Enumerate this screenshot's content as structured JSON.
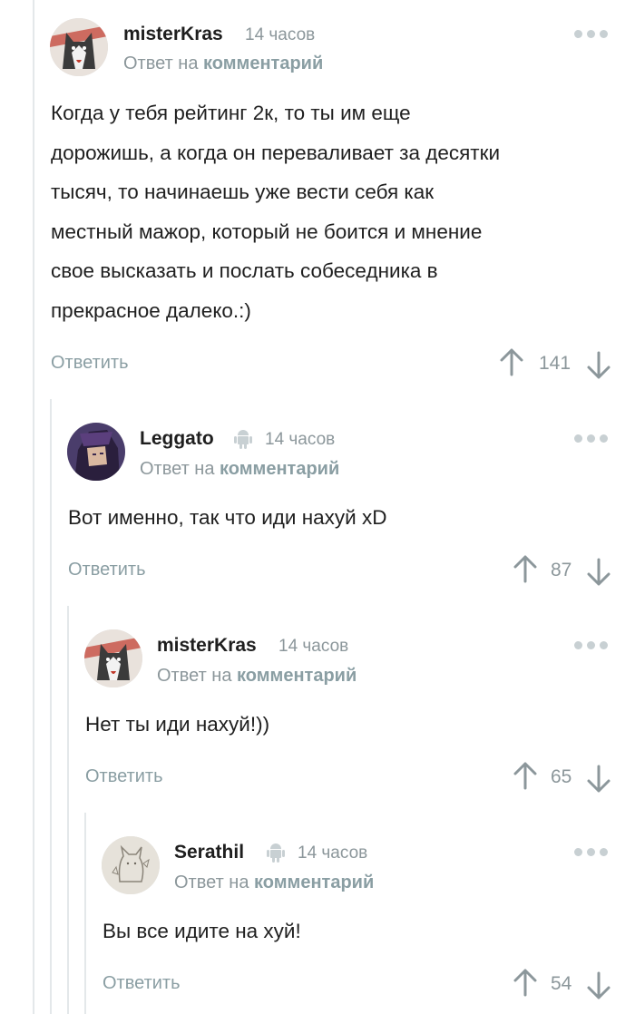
{
  "colors": {
    "accent_link": "#8a9ea3",
    "muted_text": "#8c979b",
    "thread_line": "#e4e8ea",
    "icon_gray": "#c8d0d3"
  },
  "comments": [
    {
      "author": "misterKras",
      "time": "14 часов",
      "reply_prefix": "Ответ на",
      "reply_link": "комментарий",
      "avatar": "husky-avatar",
      "has_android_icon": false,
      "text_lines": [
        "Когда у тебя рейтинг 2к, то ты им еще",
        "дорожишь, а когда он переваливает за десятки",
        "тысяч, то начинаешь уже вести себя как",
        "местный мажор, который не боится и мнение",
        "свое высказать и послать собеседника в",
        "прекрасное далеко.:)"
      ],
      "reply_button": "Ответить",
      "rating": "141"
    },
    {
      "author": "Leggato",
      "time": "14 часов",
      "reply_prefix": "Ответ на",
      "reply_link": "комментарий",
      "avatar": "anime-character-avatar",
      "has_android_icon": true,
      "text_lines": [
        "Вот именно, так что иди нахуй xD"
      ],
      "reply_button": "Ответить",
      "rating": "87"
    },
    {
      "author": "misterKras",
      "time": "14 часов",
      "reply_prefix": "Ответ на",
      "reply_link": "комментарий",
      "avatar": "husky-avatar",
      "has_android_icon": false,
      "text_lines": [
        "Нет ты иди нахуй!))"
      ],
      "reply_button": "Ответить",
      "rating": "65"
    },
    {
      "author": "Serathil",
      "time": "14 часов",
      "reply_prefix": "Ответ на",
      "reply_link": "комментарий",
      "avatar": "cat-sketch-avatar",
      "has_android_icon": true,
      "text_lines": [
        "Вы все идите на хуй!"
      ],
      "reply_button": "Ответить",
      "rating": "54"
    }
  ]
}
